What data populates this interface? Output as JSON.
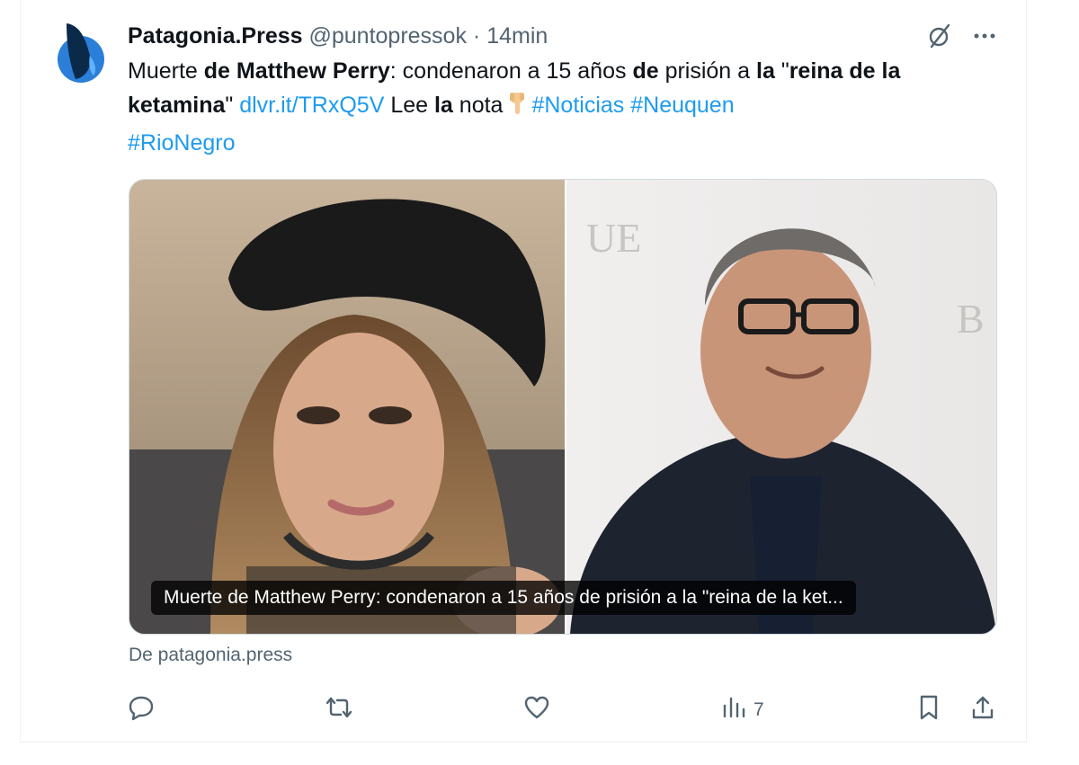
{
  "tweet": {
    "display_name": "Patagonia.Press",
    "handle": "@puntopressok",
    "separator": "·",
    "time": "14min",
    "text": {
      "p1": "Muerte ",
      "b1": "de Matthew Perry",
      "p2": ": condenaron a 15 años ",
      "b2": "de",
      "p3": " prisión a ",
      "b3": "la",
      "p4": " \"",
      "b4": "reina de la ketamina",
      "p5": "\" ",
      "link": "dlvr.it/TRxQ5V",
      "p6": " Lee ",
      "b5": "la",
      "p7": " nota",
      "tag1": "#Noticias",
      "tag2": "#Neuquen",
      "tag3": "#RioNegro"
    },
    "media_caption": "Muerte de Matthew Perry: condenaron a 15 años de prisión a la \"reina de la ket...",
    "source": "De patagonia.press",
    "views_count": "7"
  },
  "colors": {
    "link": "#1d9bf0",
    "secondary_text": "#536471",
    "border": "#cfd9de",
    "avatar_blue": "#2b7fd8",
    "avatar_dark": "#0b2a4a"
  },
  "icons": {
    "header": [
      "grok-icon",
      "more-icon"
    ],
    "actions": [
      "reply-icon",
      "retweet-icon",
      "like-icon",
      "views-icon",
      "bookmark-icon",
      "share-icon"
    ],
    "emoji": "backhand-index-pointing-down"
  }
}
